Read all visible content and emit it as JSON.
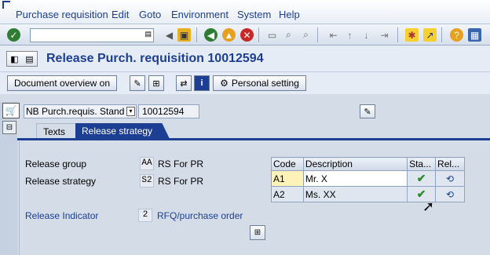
{
  "menu": {
    "items": [
      "Purchase requisition",
      "Edit",
      "Goto",
      "Environment",
      "System",
      "Help"
    ]
  },
  "toolbar": {
    "command_value": ""
  },
  "title": {
    "text": "Release Purch. requisition 10012594"
  },
  "app_toolbar": {
    "doc_overview_label": "Document overview on",
    "personal_setting_label": "Personal setting"
  },
  "header": {
    "doc_type": "NB Purch.requis. Stand",
    "doc_number": "10012594"
  },
  "tabs": [
    {
      "label": "Texts",
      "active": false
    },
    {
      "label": "Release strategy",
      "active": true
    }
  ],
  "release": {
    "group_label": "Release group",
    "group_code": "AA",
    "group_value": "RS For PR",
    "strategy_label": "Release strategy",
    "strategy_code": "S2",
    "strategy_value": "RS For PR",
    "indicator_label": "Release Indicator",
    "indicator_code": "2",
    "indicator_value": "RFQ/purchase order"
  },
  "grid": {
    "headers": [
      "Code",
      "Description",
      "Sta...",
      "Rel..."
    ],
    "rows": [
      {
        "code": "A1",
        "description": "Mr. X",
        "status": "released"
      },
      {
        "code": "A2",
        "description": "Ms. XX",
        "status": "released"
      }
    ]
  },
  "colors": {
    "accent": "#1c3f94",
    "code_highlight": "#fff2b8",
    "check": "#2e8b2e"
  }
}
